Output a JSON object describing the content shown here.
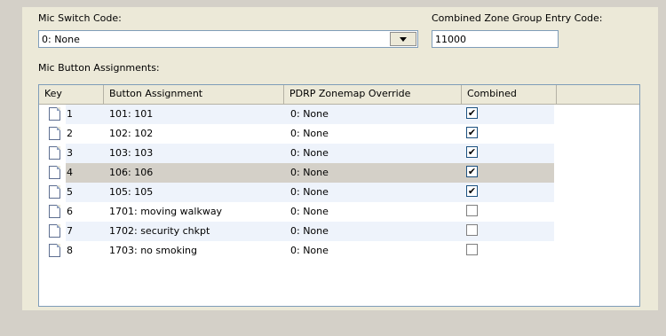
{
  "mic_switch": {
    "label": "Mic Switch Code:",
    "selected": "0: None"
  },
  "combined_zone": {
    "label": "Combined Zone Group Entry Code:",
    "value": "11000"
  },
  "assignments": {
    "label": "Mic Button Assignments:",
    "columns": [
      "Key",
      "Button Assignment",
      "PDRP Zonemap Override",
      "Combined"
    ],
    "rows": [
      {
        "key": "1",
        "assignment": "101: 101",
        "override": "0: None",
        "combined": true
      },
      {
        "key": "2",
        "assignment": "102: 102",
        "override": "0: None",
        "combined": true
      },
      {
        "key": "3",
        "assignment": "103: 103",
        "override": "0: None",
        "combined": true
      },
      {
        "key": "4",
        "assignment": "106: 106",
        "override": "0: None",
        "combined": true
      },
      {
        "key": "5",
        "assignment": "105: 105",
        "override": "0: None",
        "combined": true
      },
      {
        "key": "6",
        "assignment": "1701: moving walkway",
        "override": "0: None",
        "combined": false
      },
      {
        "key": "7",
        "assignment": "1702: security chkpt",
        "override": "0: None",
        "combined": false
      },
      {
        "key": "8",
        "assignment": "1703: no smoking",
        "override": "0: None",
        "combined": false
      }
    ],
    "selected_row": 3,
    "check_glyph": "✔",
    "row_icon": "document-icon"
  }
}
